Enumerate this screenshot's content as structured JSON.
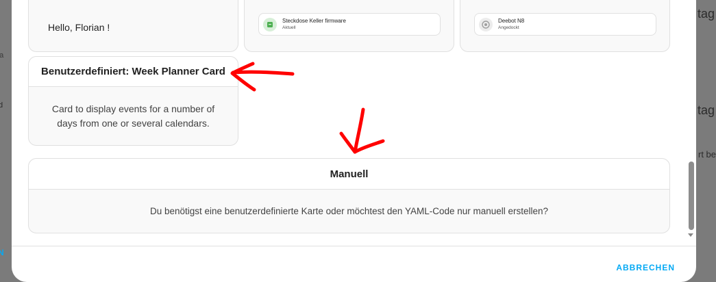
{
  "background": {
    "right_top": "tag",
    "right_mid": "tag",
    "right_low": "rt bei",
    "left_a": "tba",
    "left_b": "d",
    "left_c": "N"
  },
  "greeting_card": {
    "text": "Hello, Florian !"
  },
  "tile_1": {
    "name": "Steckdose Keller firmware",
    "state": "Aktuell",
    "icon": "package-icon",
    "color": "#4caf50"
  },
  "tile_2": {
    "name": "Deebot N8",
    "state": "Angedockt",
    "icon": "robot-vacuum-icon",
    "color": "#9e9e9e"
  },
  "week_planner_card": {
    "title": "Benutzerdefiniert: Week Planner Card",
    "description_line1": "Card to display events for a number of",
    "description_line2": "days from one or several calendars."
  },
  "manual_card": {
    "title": "Manuell",
    "description": "Du benötigst eine benutzerdefinierte Karte oder möchtest den YAML-Code nur manuell erstellen?"
  },
  "dialog": {
    "cancel_label": "ABBRECHEN"
  },
  "colors": {
    "accent": "#03a9f4",
    "annotation": "#ff0000"
  }
}
